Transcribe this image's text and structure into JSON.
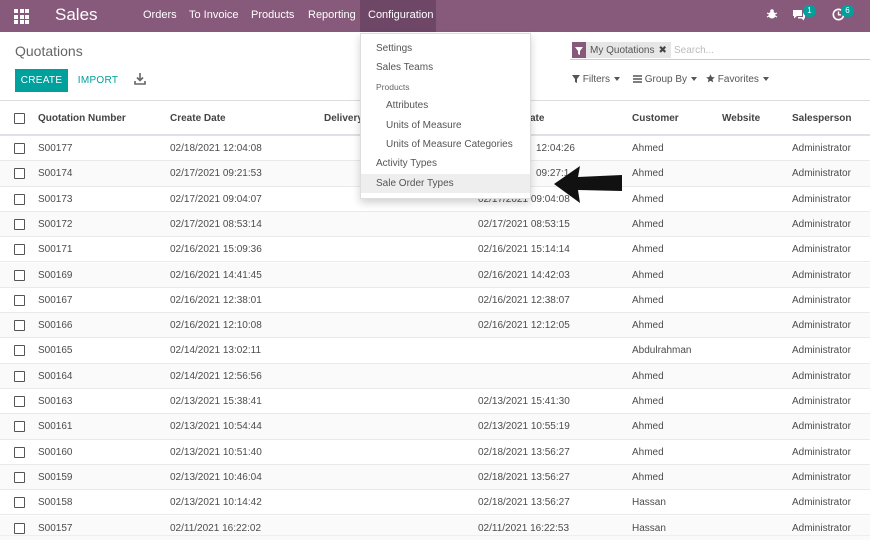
{
  "navbar": {
    "brand": "Sales",
    "menu": [
      "Orders",
      "To Invoice",
      "Products",
      "Reporting",
      "Configuration"
    ],
    "active_menu": "Configuration",
    "messages_badge": "1",
    "activity_badge": "6",
    "accent_color": "#875a7b"
  },
  "control_panel": {
    "title": "Quotations",
    "create_label": "CREATE",
    "import_label": "IMPORT",
    "search_facet": "My Quotations",
    "search_placeholder": "Search...",
    "filters_label": "Filters",
    "groupby_label": "Group By",
    "favorites_label": "Favorites",
    "primary_color": "#00a09d"
  },
  "table": {
    "headers": {
      "number": "Quotation Number",
      "create_date": "Create Date",
      "delivery": "Delivery",
      "order_date": "ate",
      "customer": "Customer",
      "website": "Website",
      "salesperson": "Salesperson"
    },
    "rows": [
      {
        "number": "S00177",
        "create_date": "02/18/2021 12:04:08",
        "order_date": "12:04:26",
        "customer": "Ahmed",
        "salesperson": "Administrator"
      },
      {
        "number": "S00174",
        "create_date": "02/17/2021 09:21:53",
        "order_date": "09:27:1",
        "customer": "Ahmed",
        "salesperson": "Administrator"
      },
      {
        "number": "S00173",
        "create_date": "02/17/2021 09:04:07",
        "order_date": "02/17/2021 09:04:08",
        "customer": "Ahmed",
        "salesperson": "Administrator"
      },
      {
        "number": "S00172",
        "create_date": "02/17/2021 08:53:14",
        "order_date": "02/17/2021 08:53:15",
        "customer": "Ahmed",
        "salesperson": "Administrator"
      },
      {
        "number": "S00171",
        "create_date": "02/16/2021 15:09:36",
        "order_date": "02/16/2021 15:14:14",
        "customer": "Ahmed",
        "salesperson": "Administrator"
      },
      {
        "number": "S00169",
        "create_date": "02/16/2021 14:41:45",
        "order_date": "02/16/2021 14:42:03",
        "customer": "Ahmed",
        "salesperson": "Administrator"
      },
      {
        "number": "S00167",
        "create_date": "02/16/2021 12:38:01",
        "order_date": "02/16/2021 12:38:07",
        "customer": "Ahmed",
        "salesperson": "Administrator"
      },
      {
        "number": "S00166",
        "create_date": "02/16/2021 12:10:08",
        "order_date": "02/16/2021 12:12:05",
        "customer": "Ahmed",
        "salesperson": "Administrator"
      },
      {
        "number": "S00165",
        "create_date": "02/14/2021 13:02:11",
        "order_date": "",
        "customer": "Abdulrahman",
        "salesperson": "Administrator"
      },
      {
        "number": "S00164",
        "create_date": "02/14/2021 12:56:56",
        "order_date": "",
        "customer": "Ahmed",
        "salesperson": "Administrator"
      },
      {
        "number": "S00163",
        "create_date": "02/13/2021 15:38:41",
        "order_date": "02/13/2021 15:41:30",
        "customer": "Ahmed",
        "salesperson": "Administrator"
      },
      {
        "number": "S00161",
        "create_date": "02/13/2021 10:54:44",
        "order_date": "02/13/2021 10:55:19",
        "customer": "Ahmed",
        "salesperson": "Administrator"
      },
      {
        "number": "S00160",
        "create_date": "02/13/2021 10:51:40",
        "order_date": "02/18/2021 13:56:27",
        "customer": "Ahmed",
        "salesperson": "Administrator"
      },
      {
        "number": "S00159",
        "create_date": "02/13/2021 10:46:04",
        "order_date": "02/18/2021 13:56:27",
        "customer": "Ahmed",
        "salesperson": "Administrator"
      },
      {
        "number": "S00158",
        "create_date": "02/13/2021 10:14:42",
        "order_date": "02/18/2021 13:56:27",
        "customer": "Hassan",
        "salesperson": "Administrator"
      },
      {
        "number": "S00157",
        "create_date": "02/11/2021 16:22:02",
        "order_date": "02/11/2021 16:22:53",
        "customer": "Hassan",
        "salesperson": "Administrator"
      }
    ]
  },
  "config_menu": {
    "items": [
      {
        "label": "Settings",
        "kind": "item"
      },
      {
        "label": "Sales Teams",
        "kind": "item"
      },
      {
        "label": "Products",
        "kind": "header"
      },
      {
        "label": "Attributes",
        "kind": "sub"
      },
      {
        "label": "Units of Measure",
        "kind": "sub"
      },
      {
        "label": "Units of Measure Categories",
        "kind": "sub"
      },
      {
        "label": "Activity Types",
        "kind": "item"
      },
      {
        "label": "Sale Order Types",
        "kind": "item",
        "highlighted": true
      }
    ]
  },
  "annotation": {
    "icon": "black-arrow-left-icon"
  }
}
